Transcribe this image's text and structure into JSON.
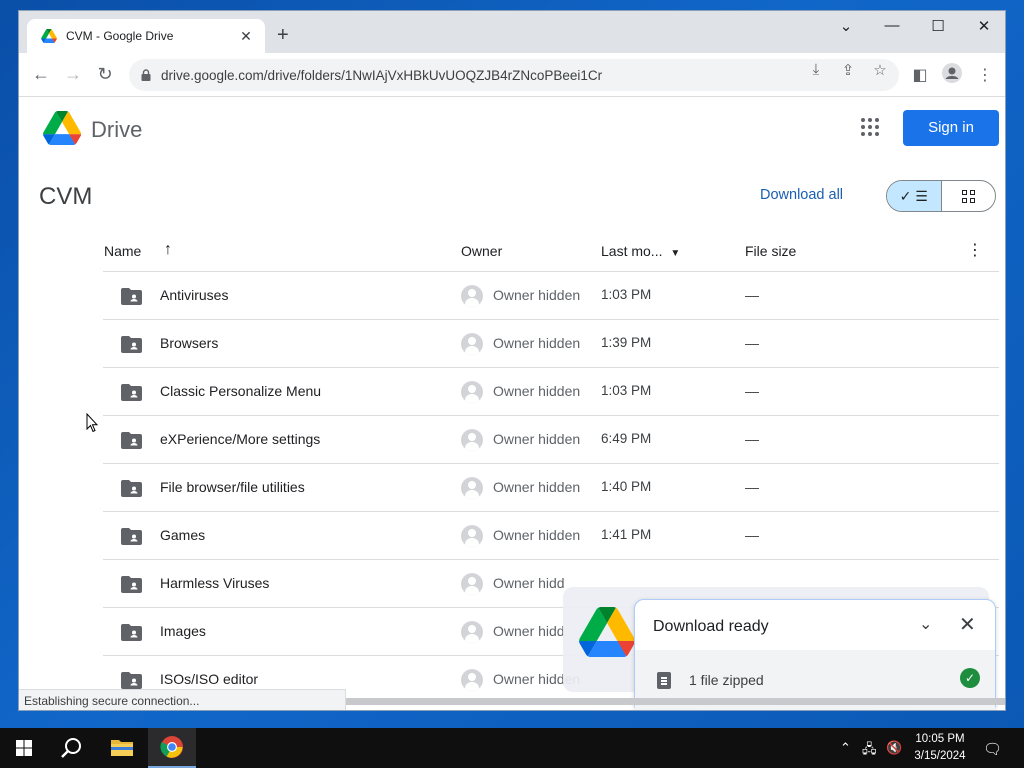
{
  "browser": {
    "tab_title": "CVM - Google Drive",
    "url": "drive.google.com/drive/folders/1NwIAjVxHBkUvUOQZJB4rZNcoPBeei1Cr",
    "status_text": "Establishing secure connection..."
  },
  "header": {
    "product_name": "Drive",
    "signin_label": "Sign in"
  },
  "folder": {
    "title": "CVM",
    "download_all_label": "Download all"
  },
  "table": {
    "columns": {
      "name": "Name",
      "owner": "Owner",
      "modified": "Last mo...",
      "size": "File size"
    },
    "rows": [
      {
        "name": "Antiviruses",
        "owner": "Owner hidden",
        "modified": "1:03 PM",
        "size": "—"
      },
      {
        "name": "Browsers",
        "owner": "Owner hidden",
        "modified": "1:39 PM",
        "size": "—"
      },
      {
        "name": "Classic Personalize Menu",
        "owner": "Owner hidden",
        "modified": "1:03 PM",
        "size": "—"
      },
      {
        "name": "eXPerience/More settings",
        "owner": "Owner hidden",
        "modified": "6:49 PM",
        "size": "—"
      },
      {
        "name": "File browser/file utilities",
        "owner": "Owner hidden",
        "modified": "1:40 PM",
        "size": "—"
      },
      {
        "name": "Games",
        "owner": "Owner hidden",
        "modified": "1:41 PM",
        "size": "—"
      },
      {
        "name": "Harmless Viruses",
        "owner": "Owner hidd",
        "modified": "",
        "size": ""
      },
      {
        "name": "Images",
        "owner": "Owner hidd",
        "modified": "",
        "size": ""
      },
      {
        "name": "ISOs/ISO editor",
        "owner": "Owner hidden",
        "modified": "",
        "size": ""
      }
    ]
  },
  "download_toast": {
    "title": "Download ready",
    "status": "1 file zipped"
  },
  "taskbar": {
    "time": "10:05 PM",
    "date": "3/15/2024"
  },
  "colors": {
    "accent": "#1a73e8",
    "toggle_selected": "#c2e7ff",
    "success": "#1e8e3e"
  }
}
